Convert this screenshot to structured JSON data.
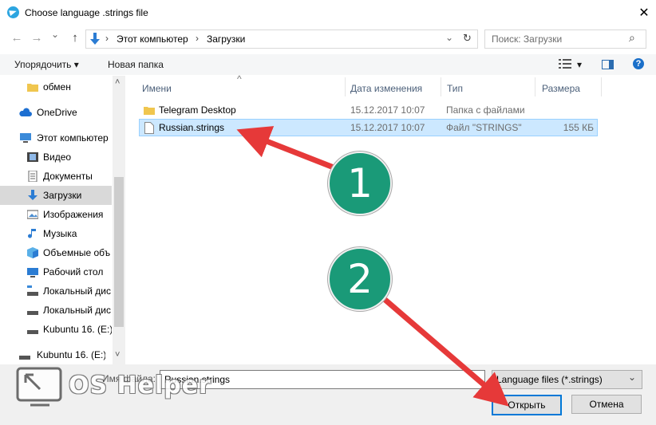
{
  "window": {
    "title": "Choose language .strings file",
    "close_glyph": "✕"
  },
  "nav": {
    "back_glyph": "←",
    "forward_glyph": "→",
    "recent_glyph": "⌄",
    "up_glyph": "↑",
    "address_segments": [
      "Этот компьютер",
      "Загрузки"
    ],
    "address_separator": "›",
    "refresh_glyph": "↻",
    "search_placeholder": "Поиск: Загрузки",
    "search_glyph": "⌕"
  },
  "toolbar": {
    "organize_label": "Упорядочить ▾",
    "new_folder_label": "Новая папка",
    "view_menu_glyph": "▾"
  },
  "sidebar": {
    "items": [
      {
        "label": "обмен",
        "icon": "folder-icon"
      },
      {
        "label": "OneDrive",
        "icon": "cloud-icon"
      },
      {
        "label": "Этот компьютер",
        "icon": "computer-icon"
      },
      {
        "label": "Видео",
        "icon": "video-icon"
      },
      {
        "label": "Документы",
        "icon": "documents-icon"
      },
      {
        "label": "Загрузки",
        "icon": "downloads-icon"
      },
      {
        "label": "Изображения",
        "icon": "pictures-icon"
      },
      {
        "label": "Музыка",
        "icon": "music-icon"
      },
      {
        "label": "Объемные объ",
        "icon": "3d-objects-icon"
      },
      {
        "label": "Рабочий стол",
        "icon": "desktop-icon"
      },
      {
        "label": "Локальный дис",
        "icon": "local-disk-icon"
      },
      {
        "label": "Локальный дис",
        "icon": "local-disk-icon"
      },
      {
        "label": "Kubuntu 16. (E:)",
        "icon": "drive-icon"
      },
      {
        "label": "Kubuntu 16. (E:)",
        "icon": "drive-icon"
      }
    ],
    "scroll_up_glyph": "˄",
    "scroll_down_glyph": "˅"
  },
  "columns": {
    "name": "Имени",
    "date": "Дата изменения",
    "type": "Тип",
    "size": "Размера",
    "sort_glyph": "^"
  },
  "files": [
    {
      "name": "Telegram Desktop",
      "date": "15.12.2017 10:07",
      "type": "Папка с файлами",
      "size": "",
      "icon": "folder-icon"
    },
    {
      "name": "Russian.strings",
      "date": "15.12.2017 10:07",
      "type": "Файл \"STRINGS\"",
      "size": "155 КБ",
      "icon": "file-icon"
    }
  ],
  "footer": {
    "filename_label": "Имя файла:",
    "filename_value": "Russian.strings",
    "filetype_value": "Language files (*.strings)",
    "dropdown_glyph": "⌄",
    "open_label": "Открыть",
    "cancel_label": "Отмена"
  },
  "annotations": {
    "badge1": "1",
    "badge2": "2",
    "watermark_text": "OS Helper",
    "arrow_color": "#e63939",
    "badge_color": "#1a9a78"
  }
}
